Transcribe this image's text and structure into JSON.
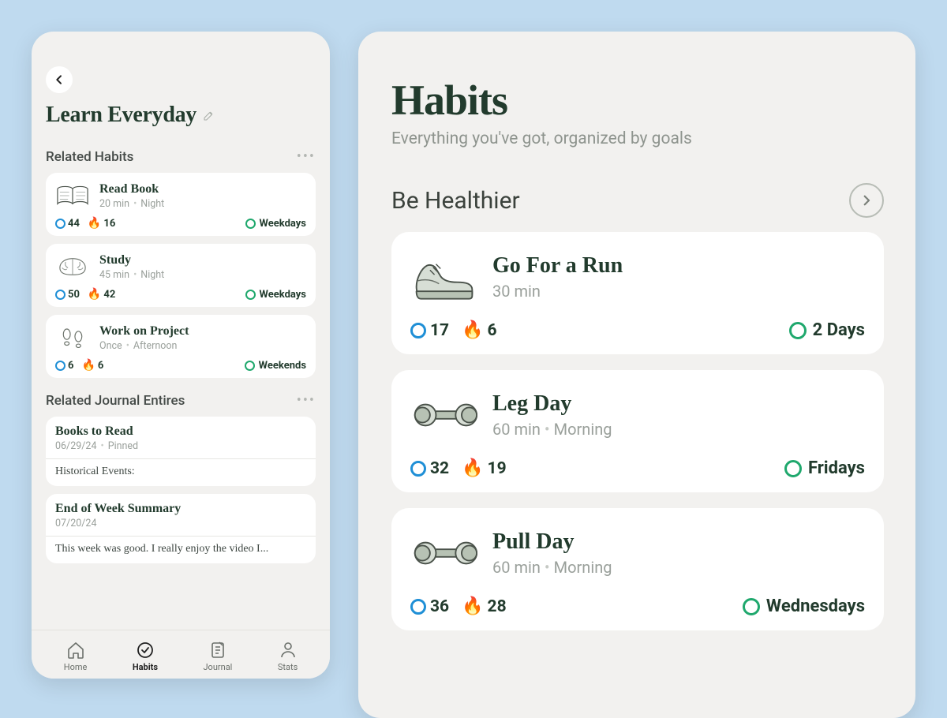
{
  "left": {
    "title": "Learn Everyday",
    "sections": {
      "relatedHabits": "Related Habits",
      "relatedJournal": "Related Journal Entires"
    },
    "habits": [
      {
        "title": "Read Book",
        "duration": "20 min",
        "time": "Night",
        "count": "44",
        "streak": "16",
        "schedule": "Weekdays"
      },
      {
        "title": "Study",
        "duration": "45 min",
        "time": "Night",
        "count": "50",
        "streak": "42",
        "schedule": "Weekdays"
      },
      {
        "title": "Work on Project",
        "duration": "Once",
        "time": "Afternoon",
        "count": "6",
        "streak": "6",
        "schedule": "Weekends"
      }
    ],
    "journal": [
      {
        "title": "Books to Read",
        "date": "06/29/24",
        "meta": "Pinned",
        "excerpt": "Historical Events:"
      },
      {
        "title": "End of Week Summary",
        "date": "07/20/24",
        "meta": "",
        "excerpt": "This week was good. I really enjoy the video I..."
      }
    ],
    "tabs": {
      "home": "Home",
      "habits": "Habits",
      "journal": "Journal",
      "stats": "Stats"
    }
  },
  "right": {
    "title": "Habits",
    "subtitle": "Everything you've got, organized by goals",
    "goal": "Be Healthier",
    "habits": [
      {
        "title": "Go For a Run",
        "duration": "30 min",
        "time": "",
        "count": "17",
        "streak": "6",
        "schedule": "2 Days"
      },
      {
        "title": "Leg Day",
        "duration": "60 min",
        "time": "Morning",
        "count": "32",
        "streak": "19",
        "schedule": "Fridays"
      },
      {
        "title": "Pull Day",
        "duration": "60 min",
        "time": "Morning",
        "count": "36",
        "streak": "28",
        "schedule": "Wednesdays"
      }
    ]
  }
}
